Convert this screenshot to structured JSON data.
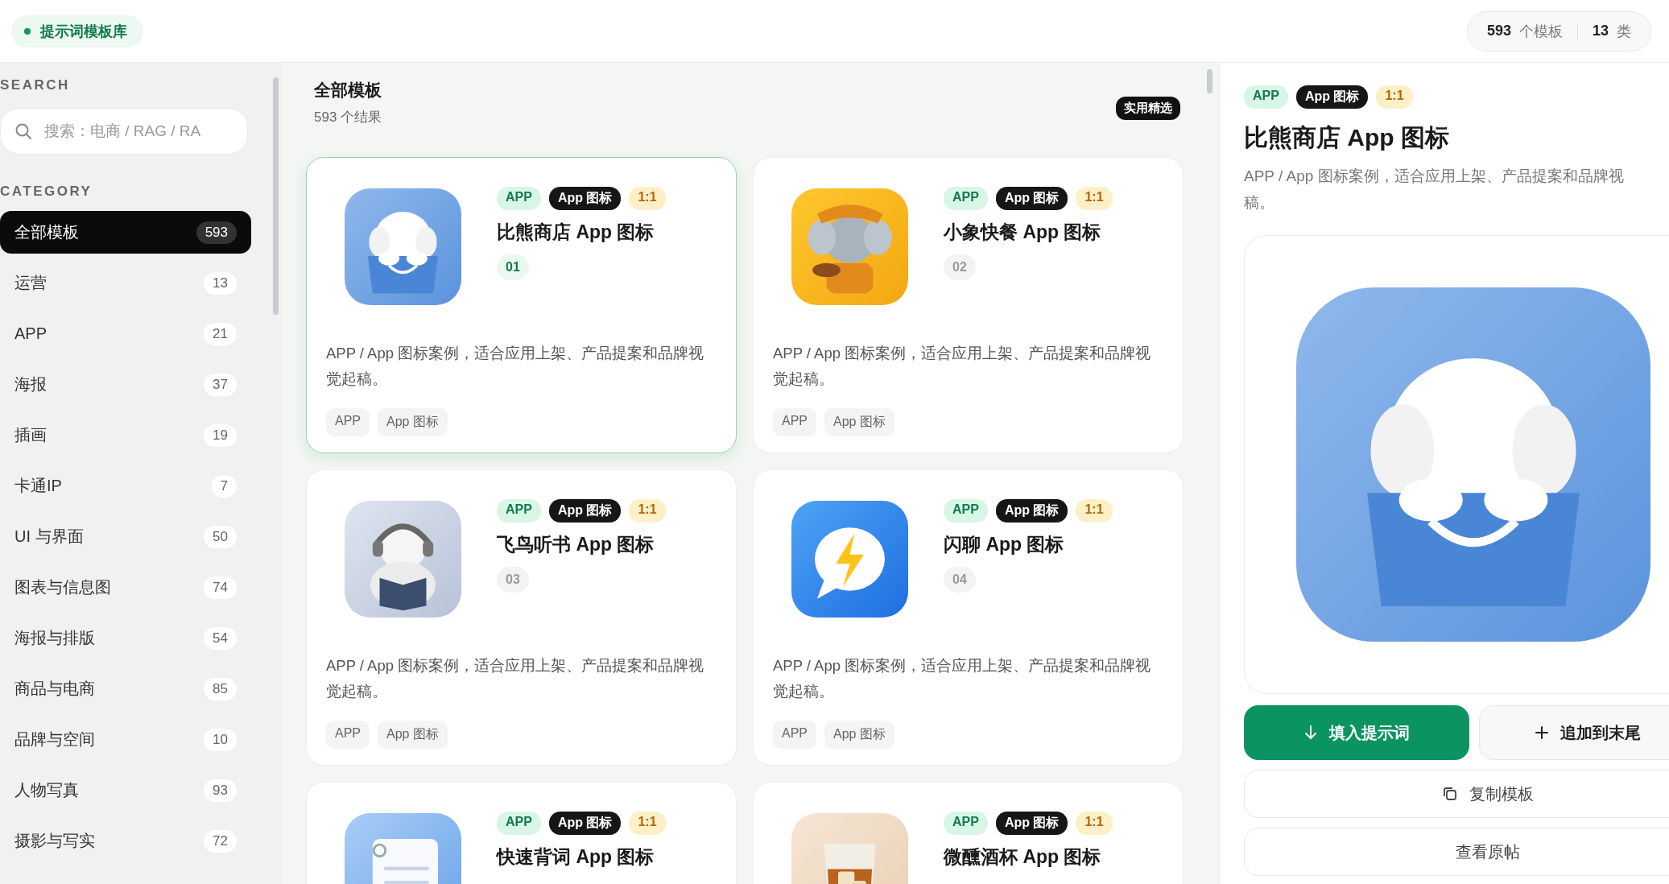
{
  "brand": {
    "title": "提示词模板库"
  },
  "stats": [
    {
      "value": "593",
      "unit": "个模板"
    },
    {
      "value": "13",
      "unit": "类"
    }
  ],
  "sidebar": {
    "search_label": "SEARCH",
    "search": {
      "placeholder": "搜索：电商 / RAG / RA"
    },
    "category_label": "CATEGORY",
    "categories": [
      {
        "label": "全部模板",
        "count": "593",
        "selected": true
      },
      {
        "label": "运营",
        "count": "13",
        "selected": false
      },
      {
        "label": "APP",
        "count": "21",
        "selected": false
      },
      {
        "label": "海报",
        "count": "37",
        "selected": false
      },
      {
        "label": "插画",
        "count": "19",
        "selected": false
      },
      {
        "label": "卡通IP",
        "count": "7",
        "selected": false
      },
      {
        "label": "UI 与界面",
        "count": "50",
        "selected": false
      },
      {
        "label": "图表与信息图",
        "count": "74",
        "selected": false
      },
      {
        "label": "海报与排版",
        "count": "54",
        "selected": false
      },
      {
        "label": "商品与电商",
        "count": "85",
        "selected": false
      },
      {
        "label": "品牌与空间",
        "count": "10",
        "selected": false
      },
      {
        "label": "人物写真",
        "count": "93",
        "selected": false
      },
      {
        "label": "摄影与写实",
        "count": "72",
        "selected": false
      }
    ]
  },
  "list": {
    "title": "全部模板",
    "count": "593 个结果",
    "badge": "实用精选",
    "cards": [
      {
        "selected": true,
        "tags": [
          {
            "label": "APP",
            "kind": "category"
          },
          {
            "label": "App 图标",
            "kind": "type"
          },
          {
            "label": "1:1",
            "kind": "ratio"
          }
        ],
        "title": "比熊商店 App 图标",
        "number": "01",
        "description": "APP / App 图标案例，适合应用上架、产品提案和品牌视觉起稿。",
        "footer_tags": [
          "APP",
          "App 图标"
        ]
      },
      {
        "selected": false,
        "tags": [
          {
            "label": "APP",
            "kind": "category"
          },
          {
            "label": "App 图标",
            "kind": "type"
          },
          {
            "label": "1:1",
            "kind": "ratio"
          }
        ],
        "title": "小象快餐 App 图标",
        "number": "02",
        "description": "APP / App 图标案例，适合应用上架、产品提案和品牌视觉起稿。",
        "footer_tags": [
          "APP",
          "App 图标"
        ]
      },
      {
        "selected": false,
        "tags": [
          {
            "label": "APP",
            "kind": "category"
          },
          {
            "label": "App 图标",
            "kind": "type"
          },
          {
            "label": "1:1",
            "kind": "ratio"
          }
        ],
        "title": "飞鸟听书 App 图标",
        "number": "03",
        "description": "APP / App 图标案例，适合应用上架、产品提案和品牌视觉起稿。",
        "footer_tags": [
          "APP",
          "App 图标"
        ]
      },
      {
        "selected": false,
        "tags": [
          {
            "label": "APP",
            "kind": "category"
          },
          {
            "label": "App 图标",
            "kind": "type"
          },
          {
            "label": "1:1",
            "kind": "ratio"
          }
        ],
        "title": "闪聊 App 图标",
        "number": "04",
        "description": "APP / App 图标案例，适合应用上架、产品提案和品牌视觉起稿。",
        "footer_tags": [
          "APP",
          "App 图标"
        ]
      },
      {
        "selected": false,
        "tags": [
          {
            "label": "APP",
            "kind": "category"
          },
          {
            "label": "App 图标",
            "kind": "type"
          },
          {
            "label": "1:1",
            "kind": "ratio"
          }
        ],
        "title": "快速背词 App 图标"
      },
      {
        "selected": false,
        "tags": [
          {
            "label": "APP",
            "kind": "category"
          },
          {
            "label": "App 图标",
            "kind": "type"
          },
          {
            "label": "1:1",
            "kind": "ratio"
          }
        ],
        "title": "微醺酒杯 App 图标"
      }
    ]
  },
  "detail": {
    "tags": [
      {
        "label": "APP",
        "kind": "category"
      },
      {
        "label": "App 图标",
        "kind": "type"
      },
      {
        "label": "1:1",
        "kind": "ratio"
      }
    ],
    "title": "比熊商店 App 图标",
    "description_lines": [
      "APP / App 图标案例，适合应用上架、产品提案和品牌视",
      "稿。"
    ],
    "buttons": [
      {
        "label": "填入提示词",
        "kind": "primary"
      },
      {
        "label": "追加到末尾",
        "kind": "append"
      },
      {
        "label": "复制模板",
        "kind": "copy"
      },
      {
        "label": "查看原帖",
        "kind": "plain"
      }
    ]
  }
}
